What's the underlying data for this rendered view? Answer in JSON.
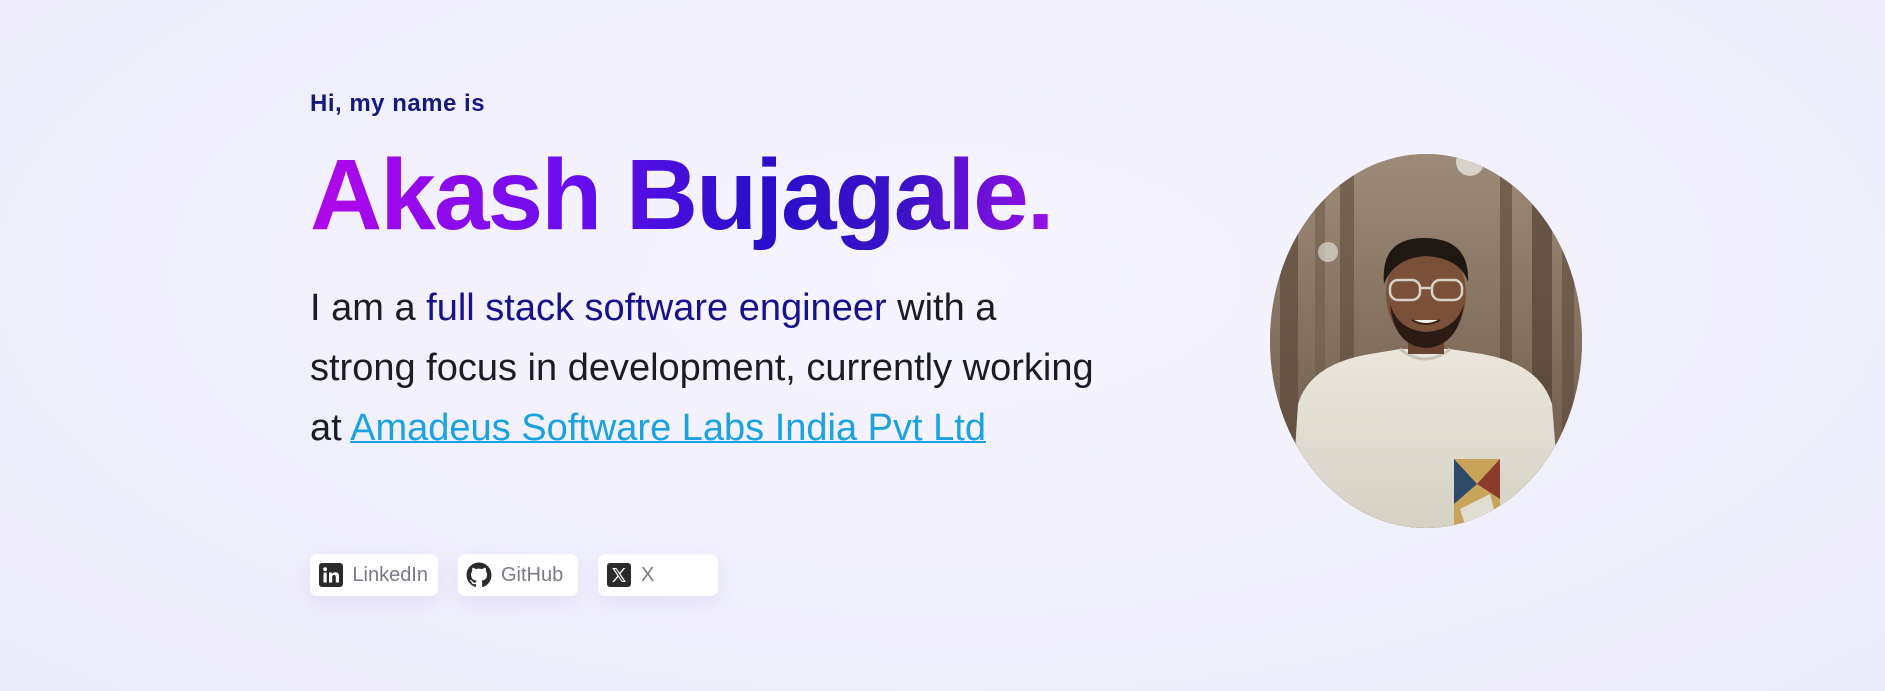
{
  "hero": {
    "greeting": "Hi, my name is",
    "name": "Akash Bujagale.",
    "intro_prefix": "I am a ",
    "intro_highlight": "full stack software engineer",
    "intro_middle": " with a strong focus in development, currently working at ",
    "company_link": "Amadeus Software Labs India Pvt Ltd"
  },
  "socials": [
    {
      "label": "LinkedIn",
      "icon": "linkedin-icon"
    },
    {
      "label": "GitHub",
      "icon": "github-icon"
    },
    {
      "label": "X",
      "icon": "x-icon"
    }
  ],
  "colors": {
    "greeting": "#151b7a",
    "highlight": "#16128c",
    "link": "#1aa3e0",
    "name_gradient_start": "#b307e8",
    "name_gradient_end": "#2a0ec9"
  }
}
